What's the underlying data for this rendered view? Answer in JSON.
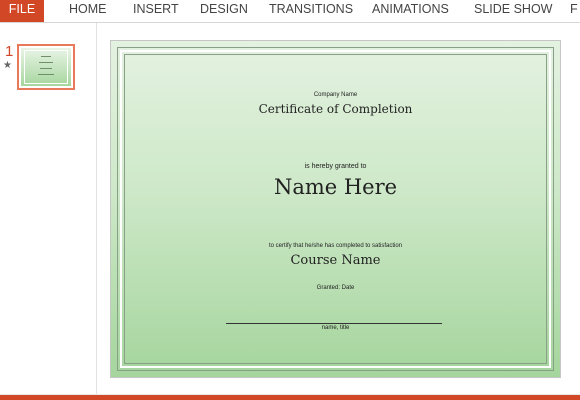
{
  "ribbon": {
    "tabs": [
      {
        "label": "FILE"
      },
      {
        "label": "HOME"
      },
      {
        "label": "INSERT"
      },
      {
        "label": "DESIGN"
      },
      {
        "label": "TRANSITIONS"
      },
      {
        "label": "ANIMATIONS"
      },
      {
        "label": "SLIDE SHOW"
      },
      {
        "label": "F"
      }
    ],
    "file_color": "#d24726"
  },
  "thumbnails": {
    "slide_number": "1",
    "star_icon": "★",
    "selected_border_color": "#e8795b"
  },
  "slide": {
    "company_name": "Company Name",
    "title": "Certificate of Completion",
    "granted_to": "is hereby granted to",
    "recipient_name": "Name Here",
    "certify_text": "to certify that he/she has completed to satisfaction",
    "course_name": "Course Name",
    "granted_date": "Granted: Date",
    "signature_caption": "name, title",
    "gradient_top": "#e4f2e1",
    "gradient_bottom": "#a5d59d"
  }
}
